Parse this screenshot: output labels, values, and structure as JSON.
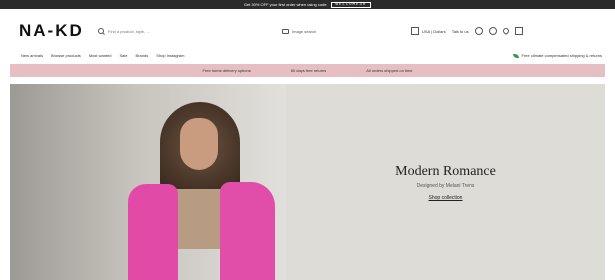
{
  "announcement": {
    "text": "Get 30% OFF your first order when using code",
    "code": "WELCOME30"
  },
  "header": {
    "logo": "NA-KD",
    "search": {
      "placeholder": "Find a product, style, …"
    },
    "image_search_label": "Image search",
    "store_label": "USA | Dollars",
    "chat_label": "Talk to us",
    "icons": [
      "account-icon",
      "settings-icon",
      "wishlist-icon",
      "bag-icon"
    ]
  },
  "nav": {
    "items": [
      "New arrivals",
      "Browse products",
      "Most wanted",
      "Sale",
      "Brands",
      "Shop Instagram"
    ]
  },
  "promo": {
    "text": "Free climate compensated shipping & returns"
  },
  "benefits": {
    "items": [
      "Free home delivery options",
      "60 days free returns",
      "All orders shipped on time"
    ]
  },
  "hero": {
    "title": "Modern Romance",
    "subtitle": "Designed by Melani Trens",
    "cta": "Shop collection"
  },
  "colors": {
    "announcement_bg": "#2b2b2b",
    "benefits_bg": "#e6bfc4",
    "hero_bg": "#dedcd7",
    "coat_pink": "#e24aa8"
  }
}
